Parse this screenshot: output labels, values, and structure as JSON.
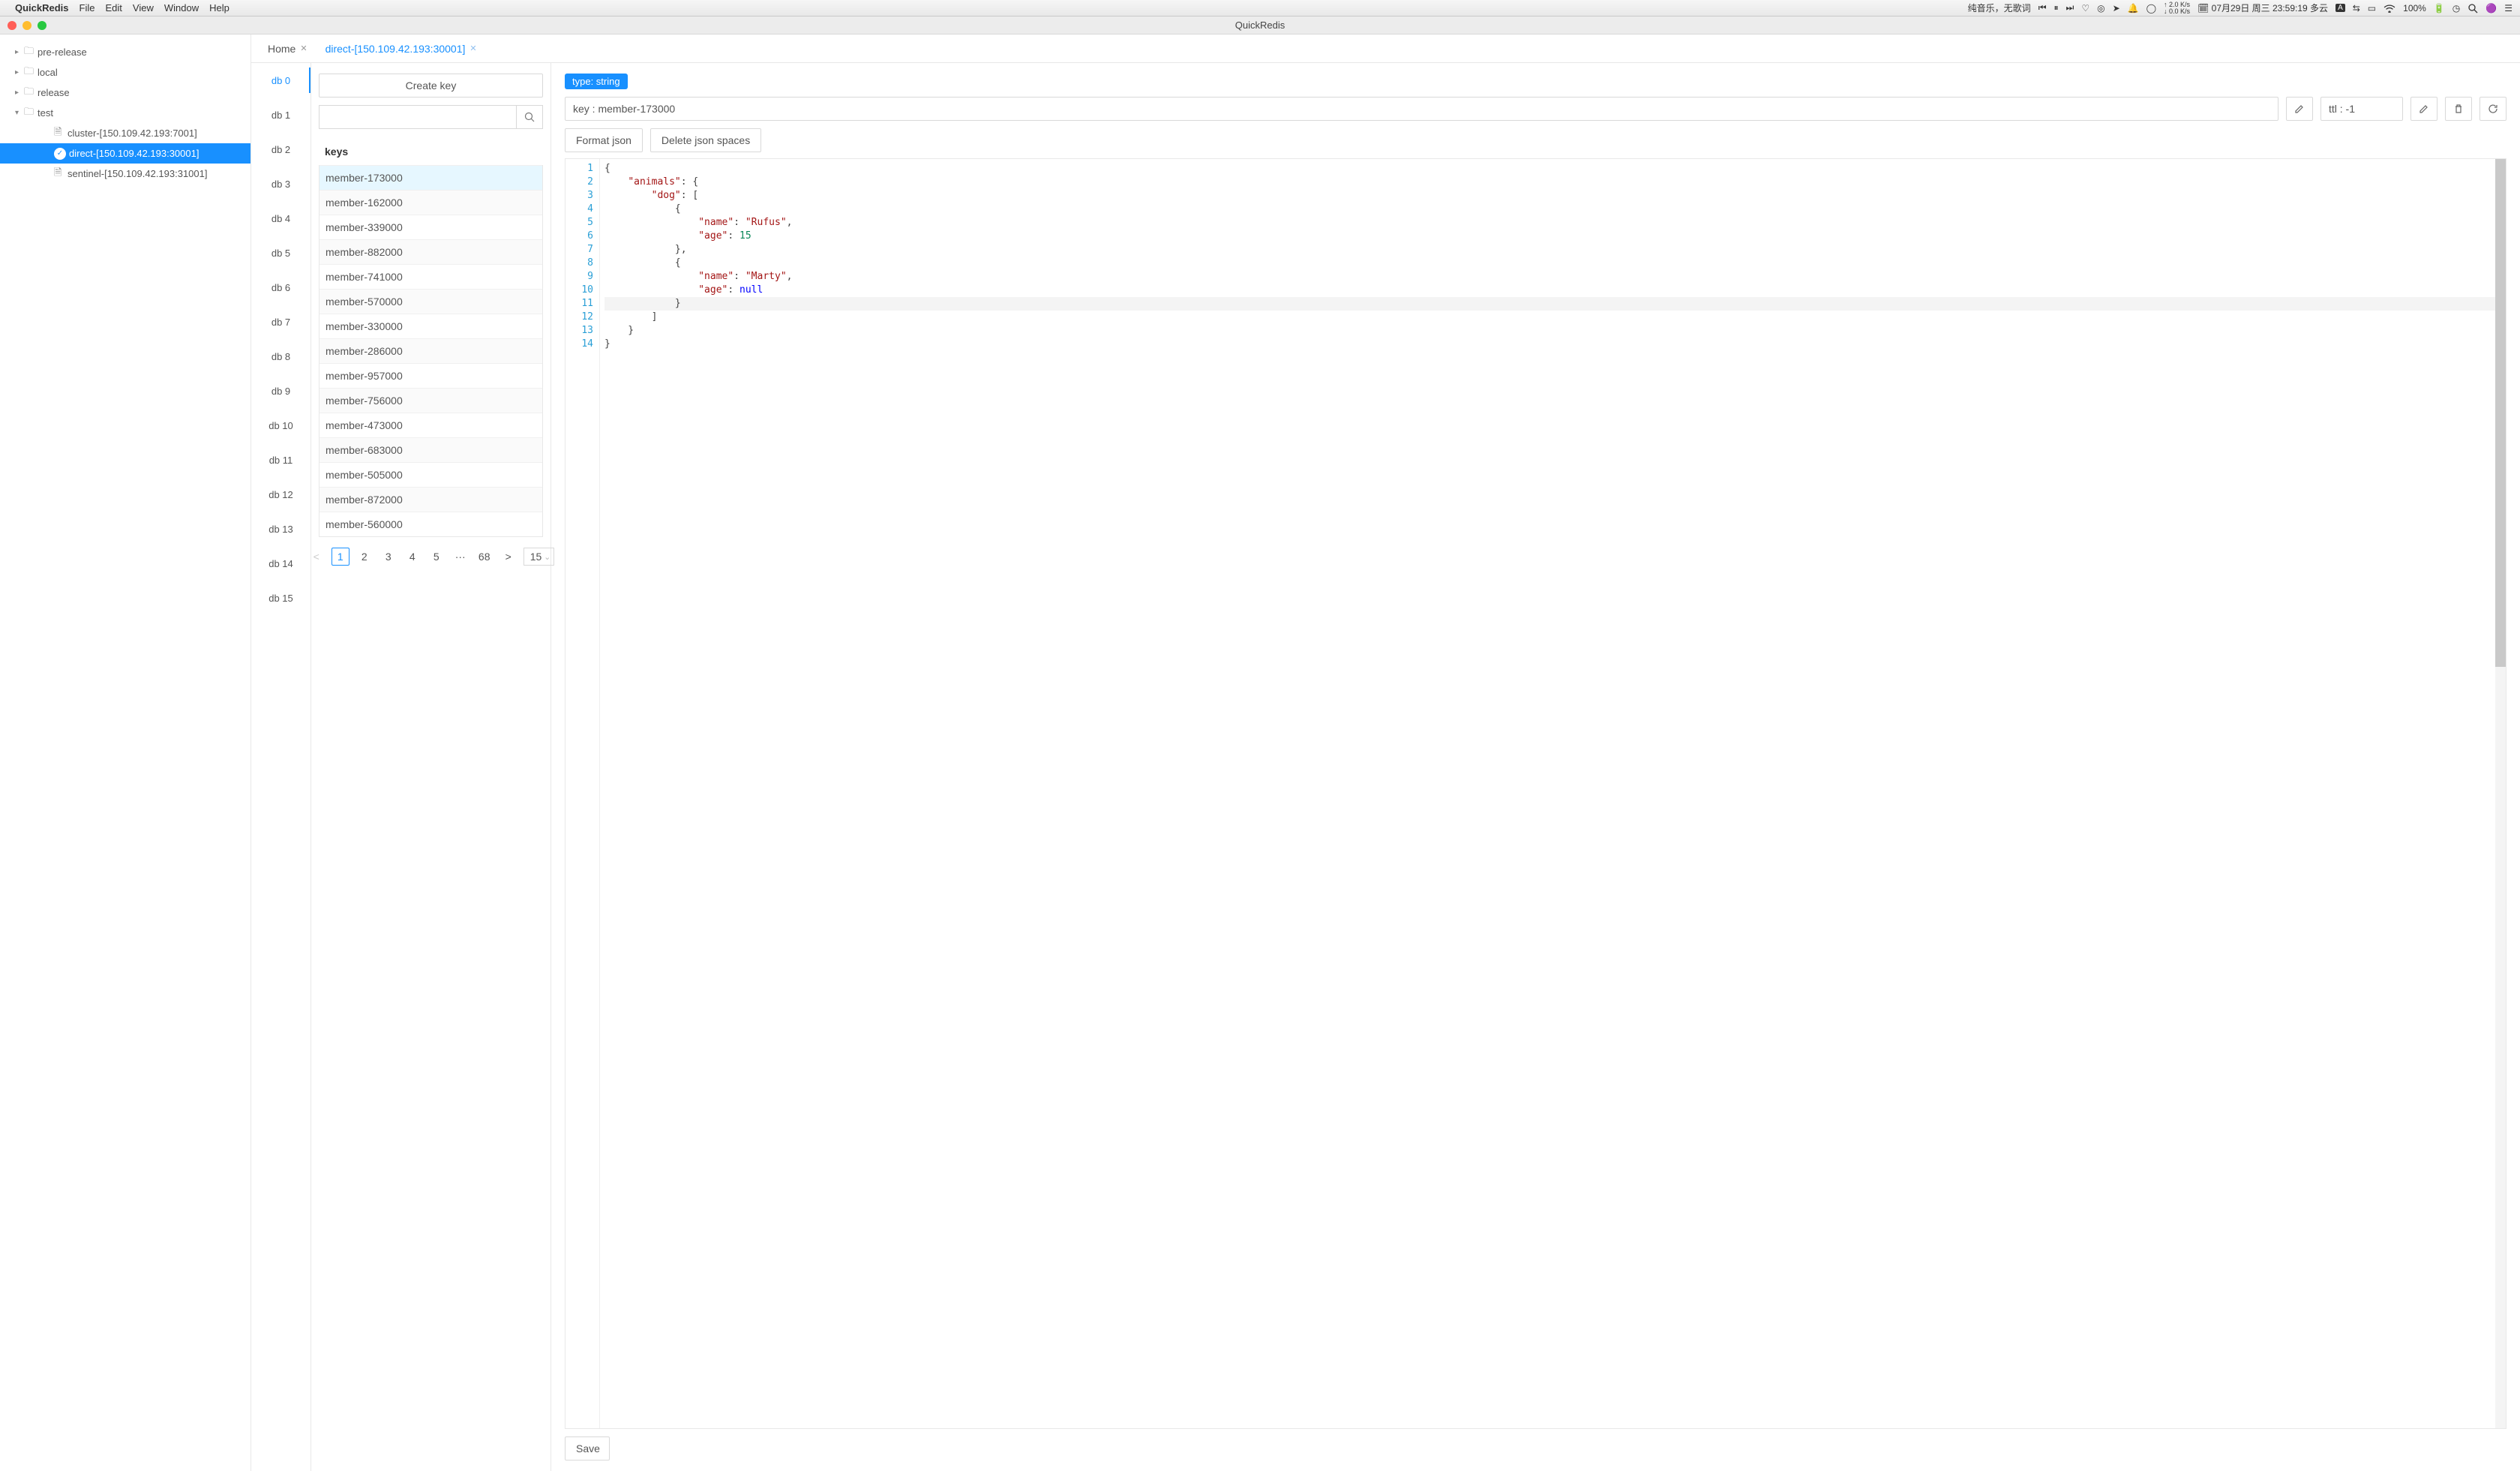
{
  "menubar": {
    "app": "QuickRedis",
    "items": [
      "File",
      "Edit",
      "View",
      "Window",
      "Help"
    ],
    "status_text": "纯音乐，无歌词",
    "net_up": "2.0 K/s",
    "net_dn": "0.0 K/s",
    "datetime": "07月29日 周三 23:59:19 多云",
    "battery": "100%"
  },
  "window": {
    "title": "QuickRedis"
  },
  "sidebar": {
    "folders": [
      {
        "name": "pre-release",
        "expanded": false
      },
      {
        "name": "local",
        "expanded": false
      },
      {
        "name": "release",
        "expanded": false
      },
      {
        "name": "test",
        "expanded": true
      }
    ],
    "test_children": [
      {
        "label": "cluster-[150.109.42.193:7001]",
        "selected": false,
        "checked": false
      },
      {
        "label": "direct-[150.109.42.193:30001]",
        "selected": true,
        "checked": true
      },
      {
        "label": "sentinel-[150.109.42.193:31001]",
        "selected": false,
        "checked": false
      }
    ]
  },
  "tabs": [
    {
      "label": "Home",
      "active": false
    },
    {
      "label": "direct-[150.109.42.193:30001]",
      "active": true
    }
  ],
  "dbs": [
    "db 0",
    "db 1",
    "db 2",
    "db 3",
    "db 4",
    "db 5",
    "db 6",
    "db 7",
    "db 8",
    "db 9",
    "db 10",
    "db 11",
    "db 12",
    "db 13",
    "db 14",
    "db 15"
  ],
  "db_active": 0,
  "keycol": {
    "create_label": "Create key",
    "search_placeholder": "",
    "header": "keys",
    "keys": [
      "member-173000",
      "member-162000",
      "member-339000",
      "member-882000",
      "member-741000",
      "member-570000",
      "member-330000",
      "member-286000",
      "member-957000",
      "member-756000",
      "member-473000",
      "member-683000",
      "member-505000",
      "member-872000",
      "member-560000"
    ],
    "selected_index": 0,
    "pagination": {
      "pages_visible": [
        "1",
        "2",
        "3",
        "4",
        "5"
      ],
      "ellipsis": "···",
      "last": "68",
      "current": "1",
      "page_size": "15"
    }
  },
  "valpane": {
    "type_badge": "type: string",
    "key_label": "key : member-173000",
    "ttl_label": "ttl : -1",
    "format_json": "Format json",
    "delete_spaces": "Delete json spaces",
    "save": "Save",
    "code_lines": [
      "{",
      "    \"animals\": {",
      "        \"dog\": [",
      "            {",
      "                \"name\": \"Rufus\",",
      "                \"age\": 15",
      "            },",
      "            {",
      "                \"name\": \"Marty\",",
      "                \"age\": null",
      "            }",
      "        ]",
      "    }",
      "}"
    ]
  }
}
